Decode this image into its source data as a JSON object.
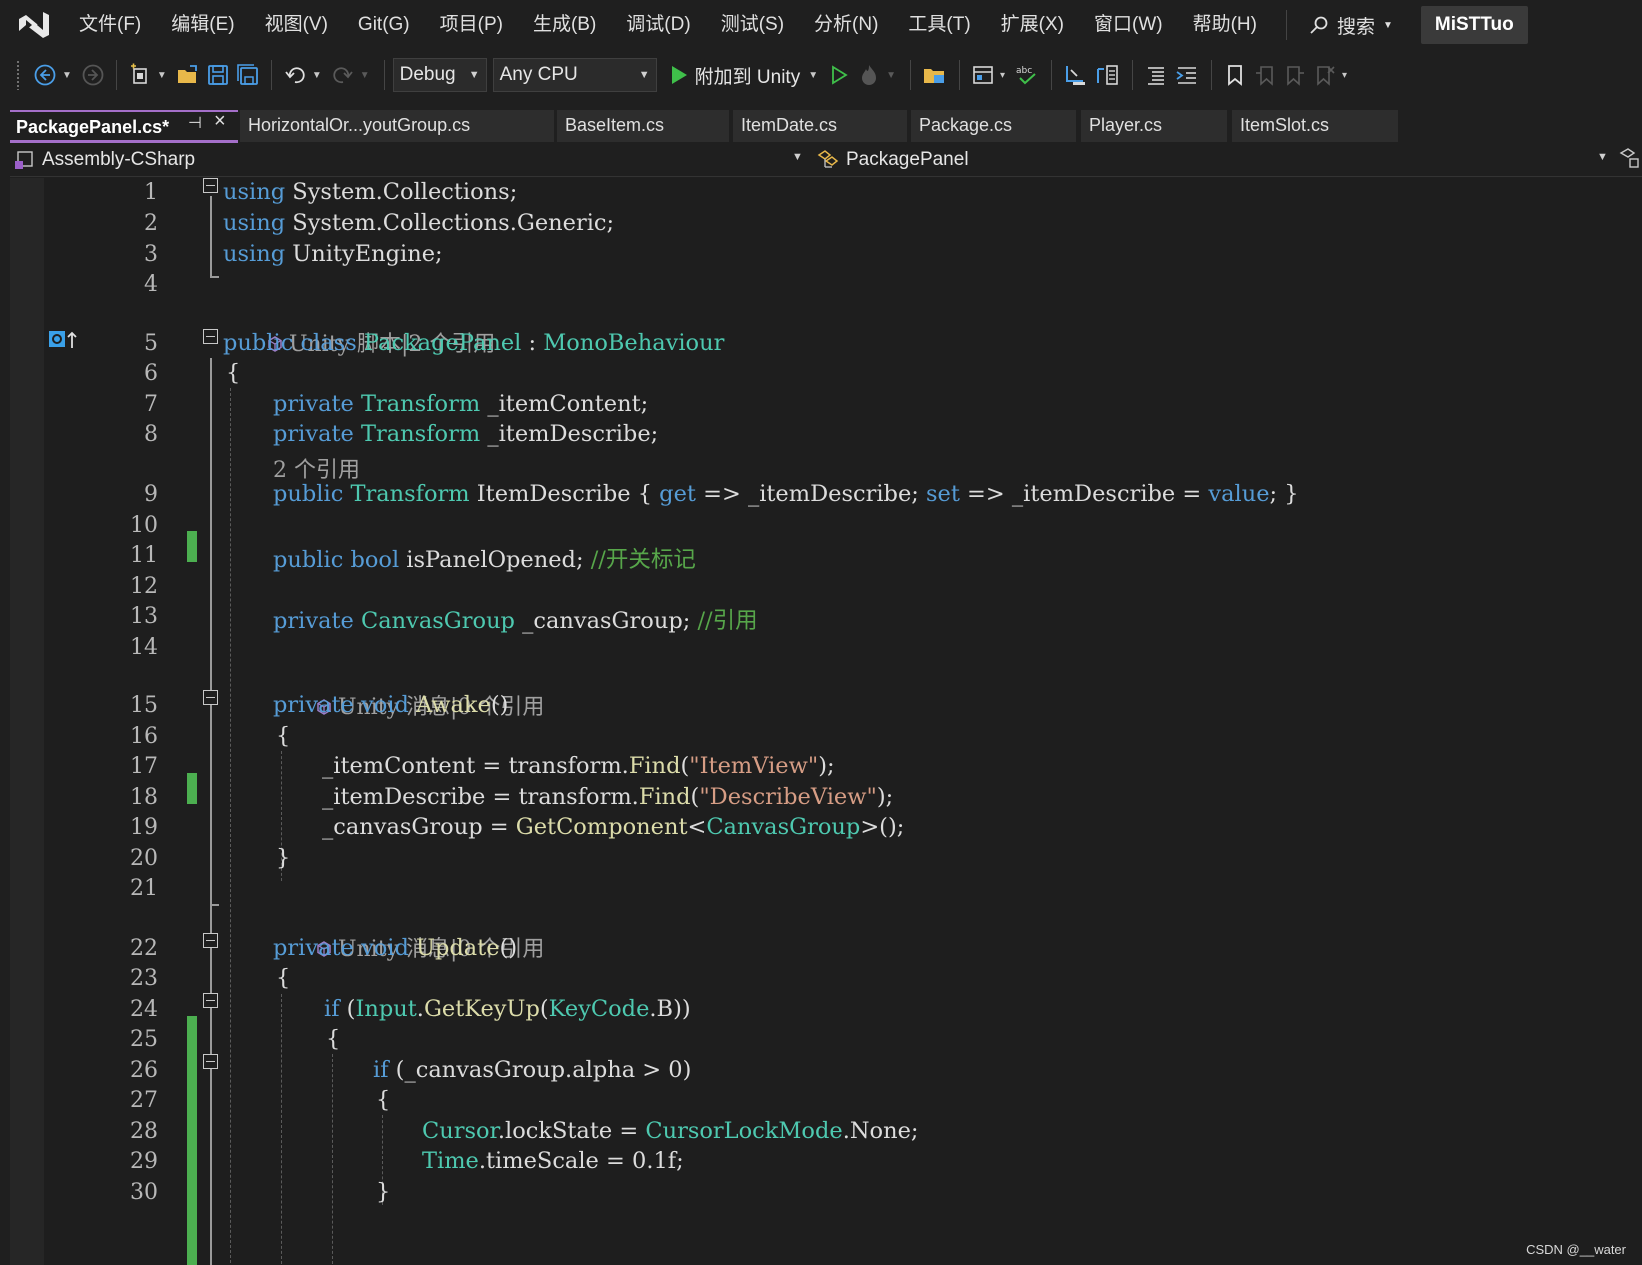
{
  "menu": {
    "items": [
      "文件(F)",
      "编辑(E)",
      "视图(V)",
      "Git(G)",
      "项目(P)",
      "生成(B)",
      "调试(D)",
      "测试(S)",
      "分析(N)",
      "工具(T)",
      "扩展(X)",
      "窗口(W)",
      "帮助(H)"
    ],
    "search_label": "搜索",
    "profile": "MiSTTuo"
  },
  "toolbar": {
    "configuration": "Debug",
    "platform": "Any CPU",
    "attach_label": "附加到 Unity"
  },
  "tabs": [
    {
      "label": "PackagePanel.cs*",
      "active": true
    },
    {
      "label": "HorizontalOr...youtGroup.cs",
      "active": false
    },
    {
      "label": "BaseItem.cs",
      "active": false
    },
    {
      "label": "ItemDate.cs",
      "active": false
    },
    {
      "label": "Package.cs",
      "active": false
    },
    {
      "label": "Player.cs",
      "active": false
    },
    {
      "label": "ItemSlot.cs",
      "active": false
    }
  ],
  "navbar": {
    "project": "Assembly-CSharp",
    "type": "PackagePanel"
  },
  "editor": {
    "lens": {
      "script": "Unity 脚本|2 个引用",
      "refs2": "2 个引用",
      "awake": "Unity 消息|0 个引用",
      "update": "Unity 消息|0 个引用"
    },
    "lines": [
      {
        "n": "1",
        "tokens": [
          [
            "kw",
            "using"
          ],
          [
            "id",
            " System.Collections;"
          ]
        ]
      },
      {
        "n": "2",
        "tokens": [
          [
            "kw",
            "using"
          ],
          [
            "id",
            " System.Collections.Generic;"
          ]
        ]
      },
      {
        "n": "3",
        "tokens": [
          [
            "kw",
            "using"
          ],
          [
            "id",
            " UnityEngine;"
          ]
        ]
      },
      {
        "n": "4",
        "tokens": []
      },
      {
        "n": "5",
        "tokens": [
          [
            "kw",
            "public class "
          ],
          [
            "ty",
            "PackagePanel"
          ],
          [
            "id",
            " : "
          ],
          [
            "ty",
            "MonoBehaviour"
          ]
        ]
      },
      {
        "n": "6",
        "tokens": [
          [
            "id",
            "{"
          ]
        ]
      },
      {
        "n": "7",
        "tokens": [
          [
            "kw",
            "private "
          ],
          [
            "ty",
            "Transform"
          ],
          [
            "id",
            " _itemContent;"
          ]
        ]
      },
      {
        "n": "8",
        "tokens": [
          [
            "kw",
            "private "
          ],
          [
            "ty",
            "Transform"
          ],
          [
            "id",
            " _itemDescribe;"
          ]
        ]
      },
      {
        "n": "9",
        "tokens": [
          [
            "kw",
            "public "
          ],
          [
            "ty",
            "Transform"
          ],
          [
            "id",
            " ItemDescribe { "
          ],
          [
            "kw",
            "get"
          ],
          [
            "id",
            " => _itemDescribe; "
          ],
          [
            "kw",
            "set"
          ],
          [
            "id",
            " => _itemDescribe = "
          ],
          [
            "kw",
            "value"
          ],
          [
            "id",
            "; }"
          ]
        ]
      },
      {
        "n": "10",
        "tokens": []
      },
      {
        "n": "11",
        "tokens": [
          [
            "kw",
            "public bool"
          ],
          [
            "id",
            " isPanelOpened; "
          ],
          [
            "cm",
            "//开关标记"
          ]
        ]
      },
      {
        "n": "12",
        "tokens": []
      },
      {
        "n": "13",
        "tokens": [
          [
            "kw",
            "private "
          ],
          [
            "ty",
            "CanvasGroup"
          ],
          [
            "id",
            " _canvasGroup; "
          ],
          [
            "cm",
            "//引用"
          ]
        ]
      },
      {
        "n": "14",
        "tokens": []
      },
      {
        "n": "15",
        "tokens": [
          [
            "kw",
            "private void "
          ],
          [
            "fn",
            "Awake"
          ],
          [
            "id",
            "()"
          ]
        ]
      },
      {
        "n": "16",
        "tokens": [
          [
            "id",
            "{"
          ]
        ]
      },
      {
        "n": "17",
        "tokens": [
          [
            "id",
            "_itemContent = transform."
          ],
          [
            "fn",
            "Find"
          ],
          [
            "id",
            "("
          ],
          [
            "str",
            "\"ItemView\""
          ],
          [
            "id",
            ");"
          ]
        ]
      },
      {
        "n": "18",
        "tokens": [
          [
            "id",
            "_itemDescribe = transform."
          ],
          [
            "fn",
            "Find"
          ],
          [
            "id",
            "("
          ],
          [
            "str",
            "\"DescribeView\""
          ],
          [
            "id",
            ");"
          ]
        ]
      },
      {
        "n": "19",
        "tokens": [
          [
            "id",
            "_canvasGroup = "
          ],
          [
            "fn",
            "GetComponent"
          ],
          [
            "id",
            "<"
          ],
          [
            "ty",
            "CanvasGroup"
          ],
          [
            "id",
            ">();"
          ]
        ]
      },
      {
        "n": "20",
        "tokens": [
          [
            "id",
            "}"
          ]
        ]
      },
      {
        "n": "21",
        "tokens": []
      },
      {
        "n": "22",
        "tokens": [
          [
            "kw",
            "private void "
          ],
          [
            "fn",
            "Update"
          ],
          [
            "id",
            "()"
          ]
        ]
      },
      {
        "n": "23",
        "tokens": [
          [
            "id",
            "{"
          ]
        ]
      },
      {
        "n": "24",
        "tokens": [
          [
            "kw",
            "if"
          ],
          [
            "id",
            " ("
          ],
          [
            "ty",
            "Input"
          ],
          [
            "id",
            "."
          ],
          [
            "fn",
            "GetKeyUp"
          ],
          [
            "id",
            "("
          ],
          [
            "ty",
            "KeyCode"
          ],
          [
            "id",
            ".B))"
          ]
        ]
      },
      {
        "n": "25",
        "tokens": [
          [
            "id",
            "{"
          ]
        ]
      },
      {
        "n": "26",
        "tokens": [
          [
            "kw",
            "if"
          ],
          [
            "id",
            " (_canvasGroup.alpha > 0)"
          ]
        ]
      },
      {
        "n": "27",
        "tokens": [
          [
            "id",
            "{"
          ]
        ]
      },
      {
        "n": "28",
        "tokens": [
          [
            "ty",
            "Cursor"
          ],
          [
            "id",
            ".lockState = "
          ],
          [
            "ty",
            "CursorLockMode"
          ],
          [
            "id",
            ".None;"
          ]
        ]
      },
      {
        "n": "29",
        "tokens": [
          [
            "ty",
            "Time"
          ],
          [
            "id",
            ".timeScale = 0.1f;"
          ]
        ]
      },
      {
        "n": "30",
        "tokens": [
          [
            "id",
            "}"
          ]
        ]
      }
    ]
  },
  "watermark": "CSDN @__water"
}
